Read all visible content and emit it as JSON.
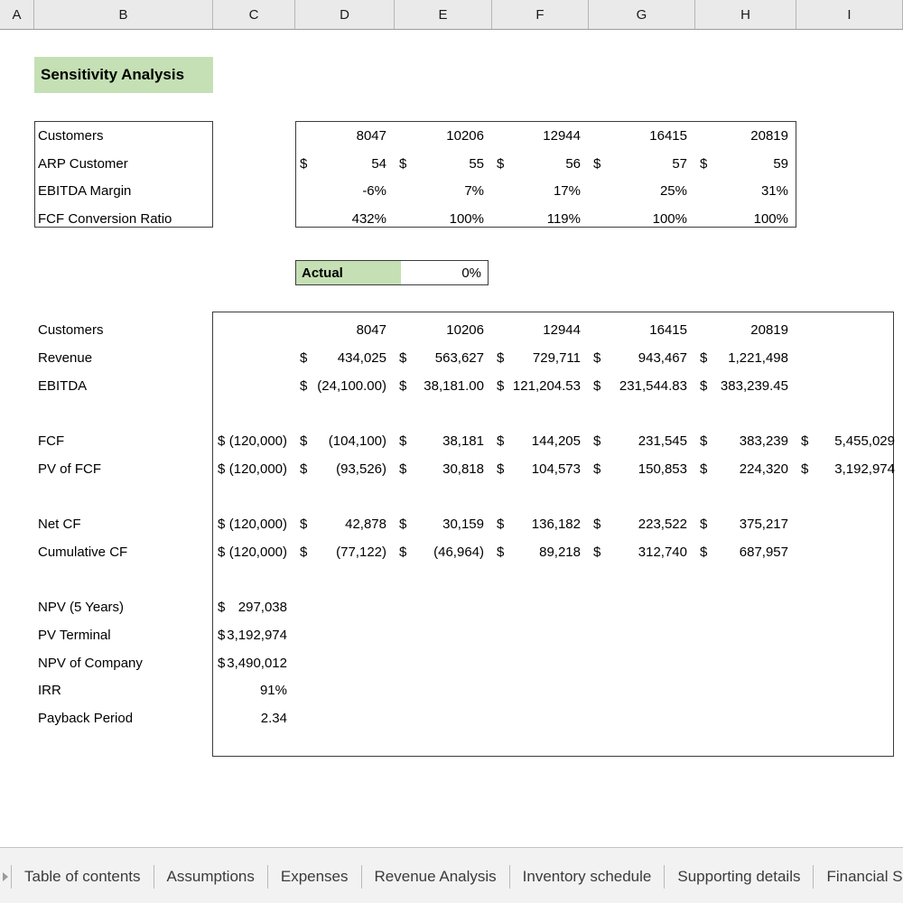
{
  "grid": {
    "column_headers": [
      "A",
      "B",
      "C",
      "D",
      "E",
      "F",
      "G",
      "H",
      "I"
    ]
  },
  "title": {
    "text": "Sensitivity Analysis",
    "fill_color": "#c5e0b4"
  },
  "assumptions_table": {
    "row_labels": [
      "Customers",
      "ARP Customer",
      "EBITDA Margin",
      "FCF Conversion Ratio"
    ],
    "rows": [
      {
        "label": "Customers",
        "currency": false,
        "values": [
          "8047",
          "10206",
          "12944",
          "16415",
          "20819"
        ]
      },
      {
        "label": "ARP Customer",
        "currency": true,
        "values": [
          "54",
          "55",
          "56",
          "57",
          "59"
        ]
      },
      {
        "label": "EBITDA Margin",
        "currency": false,
        "values": [
          "-6%",
          "7%",
          "17%",
          "25%",
          "31%"
        ]
      },
      {
        "label": "FCF Conversion Ratio",
        "currency": false,
        "values": [
          "432%",
          "100%",
          "119%",
          "100%",
          "100%"
        ]
      }
    ],
    "currency_symbol": "$"
  },
  "actual_bar": {
    "label": "Actual",
    "value": "0%",
    "label_fill": "#c5e0b4"
  },
  "model_table": {
    "currency_symbol": "$",
    "rows": [
      {
        "label": "Customers",
        "currency": false,
        "cells": [
          {
            "col": "D",
            "value": "8047"
          },
          {
            "col": "E",
            "value": "10206"
          },
          {
            "col": "F",
            "value": "12944"
          },
          {
            "col": "G",
            "value": "16415"
          },
          {
            "col": "H",
            "value": "20819"
          }
        ]
      },
      {
        "label": "Revenue",
        "currency": true,
        "cells": [
          {
            "col": "D",
            "value": "434,025"
          },
          {
            "col": "E",
            "value": "563,627"
          },
          {
            "col": "F",
            "value": "729,711"
          },
          {
            "col": "G",
            "value": "943,467"
          },
          {
            "col": "H",
            "value": "1,221,498"
          }
        ]
      },
      {
        "label": "EBITDA",
        "currency": true,
        "cells": [
          {
            "col": "D",
            "value": "(24,100.00)"
          },
          {
            "col": "E",
            "value": "38,181.00"
          },
          {
            "col": "F",
            "value": "121,204.53"
          },
          {
            "col": "G",
            "value": "231,544.83"
          },
          {
            "col": "H",
            "value": "383,239.45"
          }
        ]
      },
      {
        "label": "FCF",
        "currency": true,
        "cells": [
          {
            "col": "C",
            "value": "(120,000)"
          },
          {
            "col": "D",
            "value": "(104,100)"
          },
          {
            "col": "E",
            "value": "38,181"
          },
          {
            "col": "F",
            "value": "144,205"
          },
          {
            "col": "G",
            "value": "231,545"
          },
          {
            "col": "H",
            "value": "383,239"
          },
          {
            "col": "I",
            "value": "5,455,029"
          }
        ]
      },
      {
        "label": "PV of FCF",
        "currency": true,
        "cells": [
          {
            "col": "C",
            "value": "(120,000)"
          },
          {
            "col": "D",
            "value": "(93,526)"
          },
          {
            "col": "E",
            "value": "30,818"
          },
          {
            "col": "F",
            "value": "104,573"
          },
          {
            "col": "G",
            "value": "150,853"
          },
          {
            "col": "H",
            "value": "224,320"
          },
          {
            "col": "I",
            "value": "3,192,974"
          }
        ]
      },
      {
        "label": "Net CF",
        "currency": true,
        "cells": [
          {
            "col": "C",
            "value": "(120,000)"
          },
          {
            "col": "D",
            "value": "42,878"
          },
          {
            "col": "E",
            "value": "30,159"
          },
          {
            "col": "F",
            "value": "136,182"
          },
          {
            "col": "G",
            "value": "223,522"
          },
          {
            "col": "H",
            "value": "375,217"
          }
        ]
      },
      {
        "label": "Cumulative CF",
        "currency": true,
        "cells": [
          {
            "col": "C",
            "value": "(120,000)"
          },
          {
            "col": "D",
            "value": "(77,122)"
          },
          {
            "col": "E",
            "value": "(46,964)"
          },
          {
            "col": "F",
            "value": "89,218"
          },
          {
            "col": "G",
            "value": "312,740"
          },
          {
            "col": "H",
            "value": "687,957"
          }
        ]
      },
      {
        "label": "NPV (5 Years)",
        "currency": true,
        "cells": [
          {
            "col": "C",
            "value": "297,038"
          }
        ]
      },
      {
        "label": "PV Terminal",
        "currency": true,
        "cells": [
          {
            "col": "C",
            "value": "3,192,974"
          }
        ]
      },
      {
        "label": "NPV of Company",
        "currency": true,
        "cells": [
          {
            "col": "C",
            "value": "3,490,012"
          }
        ]
      },
      {
        "label": "IRR",
        "currency": false,
        "cells": [
          {
            "col": "C",
            "value": "91%"
          }
        ]
      },
      {
        "label": "Payback Period",
        "currency": false,
        "cells": [
          {
            "col": "C",
            "value": "2.34"
          }
        ]
      }
    ]
  },
  "sheet_tabs": {
    "scroll_icon": "chevron-right-icon",
    "items": [
      "Table of contents",
      "Assumptions",
      "Expenses",
      "Revenue Analysis",
      "Inventory schedule",
      "Supporting details",
      "Financial Statel"
    ]
  }
}
